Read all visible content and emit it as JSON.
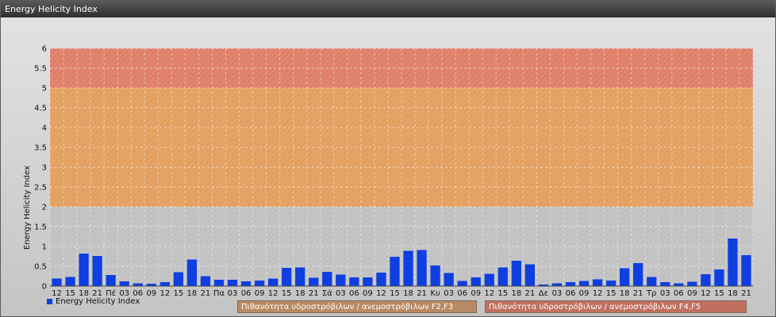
{
  "window": {
    "title": "Energy Helicity Index"
  },
  "chart_data": {
    "type": "bar",
    "title": "",
    "xlabel": "",
    "ylabel": "Energy Helicity Index",
    "ylim": [
      0,
      6
    ],
    "yticks": [
      "0",
      "0.5",
      "1",
      "1.5",
      "2",
      "2.5",
      "3",
      "3.5",
      "4",
      "4.5",
      "5",
      "5.5",
      "6"
    ],
    "grid": true,
    "legend_position": "bottom-left",
    "categories": [
      "12",
      "15",
      "18",
      "21",
      "Πέ",
      "03",
      "06",
      "09",
      "12",
      "15",
      "18",
      "21",
      "Πα",
      "03",
      "06",
      "09",
      "12",
      "15",
      "18",
      "21",
      "Σά",
      "03",
      "06",
      "09",
      "12",
      "15",
      "18",
      "21",
      "Κυ",
      "03",
      "06",
      "09",
      "12",
      "15",
      "18",
      "21",
      "Δε",
      "03",
      "06",
      "09",
      "12",
      "15",
      "18",
      "21",
      "Τρ",
      "03",
      "06",
      "09",
      "12",
      "15",
      "18",
      "21"
    ],
    "series": [
      {
        "name": "Energy Helicity Index",
        "color": "#0f3fe0",
        "values": [
          0.19,
          0.23,
          0.82,
          0.76,
          0.28,
          0.12,
          0.07,
          0.06,
          0.1,
          0.35,
          0.67,
          0.25,
          0.16,
          0.16,
          0.12,
          0.14,
          0.19,
          0.46,
          0.47,
          0.21,
          0.36,
          0.29,
          0.22,
          0.22,
          0.34,
          0.74,
          0.89,
          0.91,
          0.52,
          0.33,
          0.13,
          0.22,
          0.31,
          0.47,
          0.64,
          0.55,
          0.04,
          0.07,
          0.1,
          0.13,
          0.17,
          0.14,
          0.45,
          0.58,
          0.23,
          0.1,
          0.07,
          0.11,
          0.3,
          0.42,
          1.2,
          0.78
        ]
      }
    ],
    "bands": [
      {
        "from": 2,
        "to": 5,
        "label": "Πιθανότητα υδροστρόβιλων / ανεμοστρόβιλων F2,F3",
        "color": "#e3a060"
      },
      {
        "from": 5,
        "to": 6,
        "label": "Πιθανότητα υδροστρόβιλων / ανεμοστρόβιλων F4,F5",
        "color": "#e0806a"
      }
    ]
  }
}
